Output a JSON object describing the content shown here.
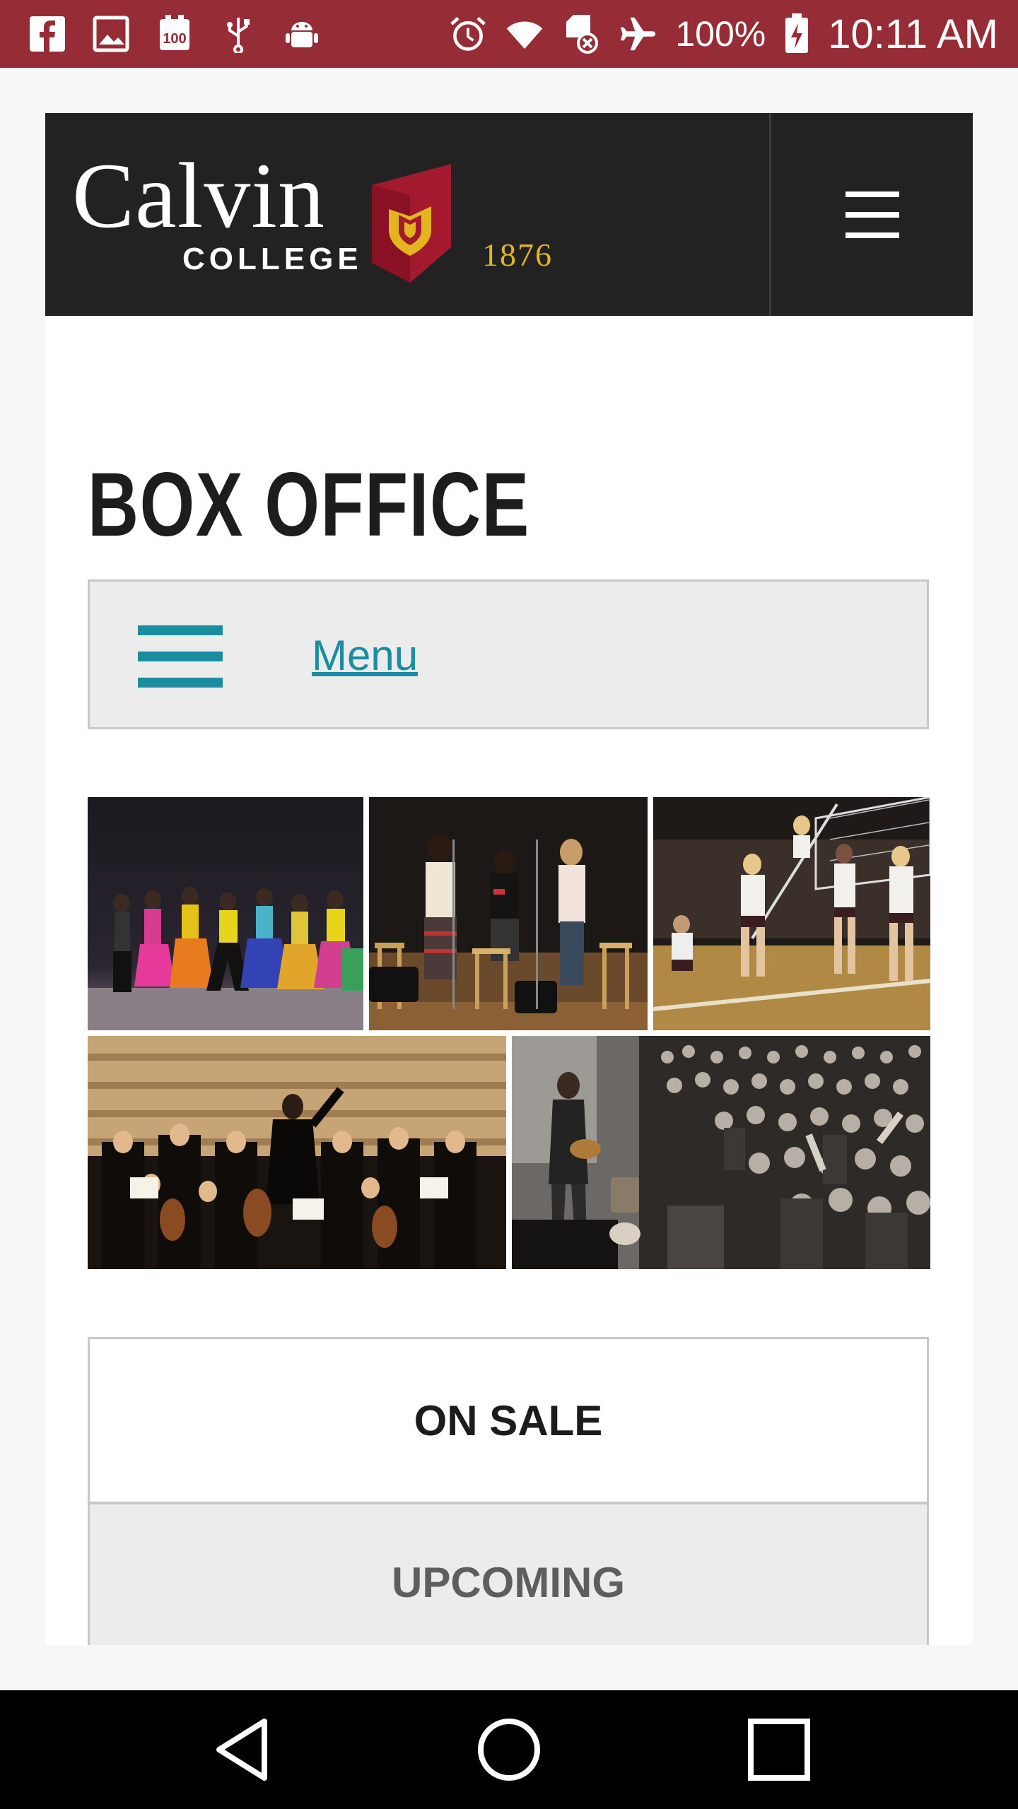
{
  "status_bar": {
    "battery": "100%",
    "time": "10:11 AM",
    "icons_left": [
      "facebook-icon",
      "gallery-icon",
      "100-badge-icon",
      "usb-icon",
      "android-debug-icon"
    ],
    "icons_right": [
      "alarm-icon",
      "wifi-icon",
      "sd-card-off-icon",
      "airplane-mode-icon",
      "battery-charging-icon"
    ],
    "background": "#962c36"
  },
  "header": {
    "logo_name": "Calvin",
    "logo_sub": "COLLEGE",
    "logo_year": "1876",
    "menu_icon": "hamburger-icon",
    "background": "#222222"
  },
  "page": {
    "title": "BOX OFFICE"
  },
  "menu": {
    "icon": "hamburger-icon",
    "label": "Menu",
    "accent": "#1a8ea0"
  },
  "collage": {
    "images": [
      "dance-performance",
      "vocal-performance",
      "volleyball-match",
      "orchestra-concert",
      "rock-concert-crowd"
    ]
  },
  "tabs": {
    "on_sale": "ON SALE",
    "upcoming": "UPCOMING"
  },
  "nav_bar": {
    "icons": [
      "back-icon",
      "home-icon",
      "recents-icon"
    ]
  }
}
